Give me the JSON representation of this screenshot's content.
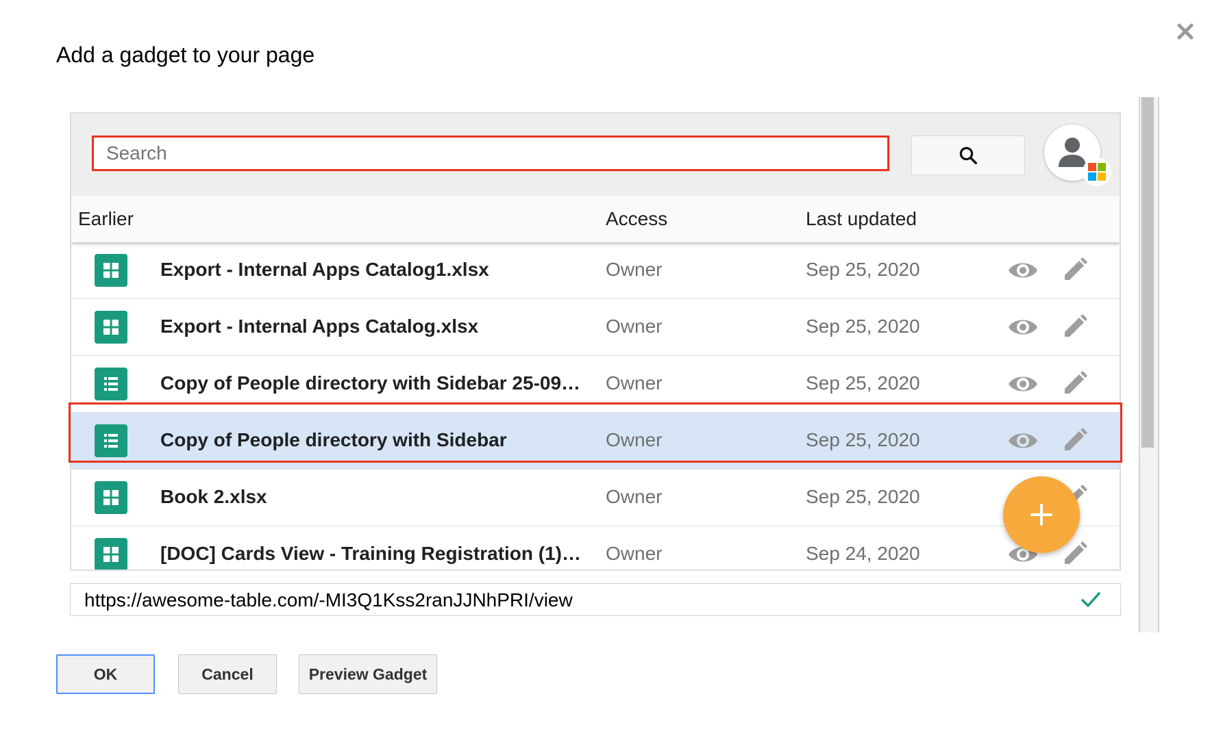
{
  "dialog": {
    "title": "Add a gadget to your page"
  },
  "search": {
    "placeholder": "Search",
    "value": ""
  },
  "columns": {
    "earlier": "Earlier",
    "access": "Access",
    "last_updated": "Last updated"
  },
  "files": [
    {
      "name": "Export - Internal Apps Catalog1.xlsx",
      "access": "Owner",
      "updated": "Sep 25, 2020",
      "icon": "spreadsheet-grid-icon",
      "selected": false
    },
    {
      "name": "Export - Internal Apps Catalog.xlsx",
      "access": "Owner",
      "updated": "Sep 25, 2020",
      "icon": "spreadsheet-grid-icon",
      "selected": false
    },
    {
      "name": "Copy of People directory with Sidebar 25-09-20…",
      "access": "Owner",
      "updated": "Sep 25, 2020",
      "icon": "spreadsheet-list-icon",
      "selected": false
    },
    {
      "name": "Copy of People directory with Sidebar",
      "access": "Owner",
      "updated": "Sep 25, 2020",
      "icon": "spreadsheet-list-icon",
      "selected": true
    },
    {
      "name": "Book 2.xlsx",
      "access": "Owner",
      "updated": "Sep 25, 2020",
      "icon": "spreadsheet-grid-icon",
      "selected": false
    },
    {
      "name": "[DOC] Cards View - Training Registration (1).xlsx",
      "access": "Owner",
      "updated": "Sep 24, 2020",
      "icon": "spreadsheet-grid-icon",
      "selected": false
    }
  ],
  "url": {
    "value": "https://awesome-table.com/-MI3Q1Kss2ranJJNhPRI/view"
  },
  "buttons": {
    "ok": "OK",
    "cancel": "Cancel",
    "preview": "Preview Gadget"
  },
  "colors": {
    "accent_green": "#1a9b7f",
    "fab_orange": "#f8a93b",
    "highlight_red": "#e8321f",
    "selected_row": "#d7e5f6",
    "ok_border": "#4d90fe"
  },
  "icons": [
    "close-icon",
    "search-icon",
    "avatar-icon",
    "microsoft-logo-icon",
    "eye-icon",
    "pencil-icon",
    "plus-icon",
    "check-icon"
  ]
}
